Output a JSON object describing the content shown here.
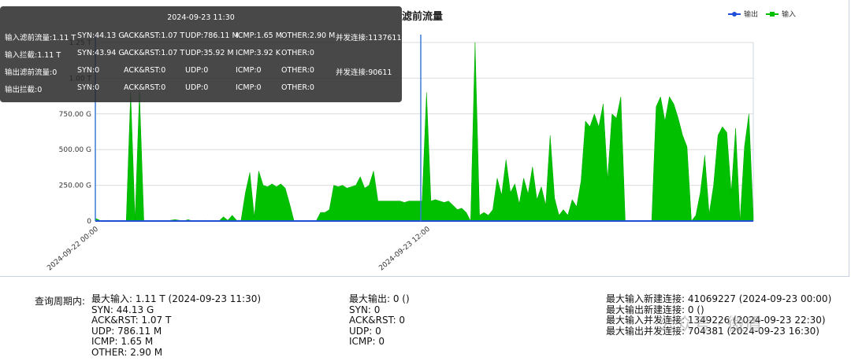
{
  "chart_data": {
    "type": "area",
    "title": "滤前流量",
    "y_ticks": [
      "0",
      "250.00 G",
      "500.00 G",
      "750.00 G",
      "1.00 T",
      "1.25 T"
    ],
    "x_ticks": [
      "2024-09-22 00:00",
      "2024-09-23 12:00"
    ],
    "ylim_G": [
      0,
      1250
    ],
    "series": [
      {
        "name": "输出",
        "color": "#1f4fd6",
        "values": [
          0,
          0,
          0,
          0,
          0,
          0,
          0,
          0,
          0,
          0,
          0,
          0,
          0,
          0,
          0,
          0,
          0,
          0,
          0,
          0,
          0,
          0,
          0,
          0,
          0,
          0,
          0,
          0,
          0,
          0,
          0,
          0,
          0,
          0,
          0,
          0,
          0,
          0,
          0,
          0,
          0,
          0,
          0,
          0,
          0,
          0,
          0,
          0,
          0,
          0
        ]
      },
      {
        "name": "输入",
        "color": "#00c000",
        "values": [
          20,
          5,
          0,
          5,
          0,
          0,
          5,
          0,
          900,
          5,
          900,
          0,
          0,
          0,
          0,
          0,
          0,
          5,
          10,
          5,
          0,
          10,
          0,
          0,
          0,
          5,
          0,
          0,
          0,
          30,
          5,
          40,
          5,
          5,
          200,
          340,
          30,
          350,
          250,
          240,
          260,
          240,
          260,
          230,
          120,
          0,
          0,
          0,
          0,
          0,
          0,
          60,
          60,
          80,
          250,
          240,
          250,
          230,
          240,
          250,
          310,
          230,
          250,
          350,
          140,
          140,
          140,
          140,
          140,
          140,
          130,
          140,
          140,
          140,
          140,
          900,
          140,
          150,
          140,
          130,
          140,
          110,
          80,
          90,
          60,
          0,
          1250,
          40,
          60,
          40,
          80,
          300,
          180,
          430,
          200,
          260,
          120,
          300,
          190,
          380,
          150,
          240,
          110,
          600,
          160,
          40,
          80,
          40,
          150,
          100,
          280,
          700,
          660,
          750,
          660,
          820,
          290,
          750,
          720,
          870,
          0,
          0,
          0,
          0,
          0,
          0,
          0,
          800,
          870,
          700,
          870,
          820,
          720,
          600,
          520,
          0,
          40,
          200,
          460,
          50,
          250,
          600,
          660,
          620,
          200,
          650,
          0,
          520,
          750,
          30
        ]
      }
    ]
  },
  "legend": {
    "out": "输出",
    "in": "输入"
  },
  "tooltip": {
    "time": "2024-09-23 11:30",
    "rows": [
      [
        "输入滤前流量:1.11 T",
        "SYN:44.13 G",
        "ACK&RST:1.07 T",
        "UDP:786.11 M",
        "ICMP:1.65 M",
        "OTHER:2.90 M",
        "并发连接:1137611"
      ],
      [
        "输入拦截:1.11 T",
        "SYN:43.94 G",
        "ACK&RST:1.07 T",
        "UDP:35.92 M",
        "ICMP:3.92 K",
        "OTHER:0",
        ""
      ],
      [
        "输出滤前流量:0",
        "SYN:0",
        "ACK&RST:0",
        "UDP:0",
        "ICMP:0",
        "OTHER:0",
        "并发连接:90611"
      ],
      [
        "输出拦截:0",
        "SYN:0",
        "ACK&RST:0",
        "UDP:0",
        "ICMP:0",
        "OTHER:0",
        ""
      ]
    ]
  },
  "stats": {
    "period_label": "查询周期内:",
    "col1": [
      "最大输入: 1.11 T (2024-09-23 11:30)",
      "SYN: 44.13 G",
      "ACK&RST: 1.07 T",
      "UDP: 786.11 M",
      "ICMP: 1.65 M",
      "OTHER: 2.90 M"
    ],
    "col2": [
      "最大输出: 0 ()",
      "SYN: 0",
      "ACK&RST: 0",
      "UDP: 0",
      "ICMP: 0"
    ],
    "col3": [
      "最大输入新建连接: 41069227 (2024-09-23 00:00)",
      "最大输出新建连接: 0 ()",
      "最大输入并发连接: 1349226 (2024-09-23 22:30)",
      "最大输出并发连接: 704381 (2024-09-23 16:30)"
    ]
  },
  "watermark": "公众号 · 微盾"
}
